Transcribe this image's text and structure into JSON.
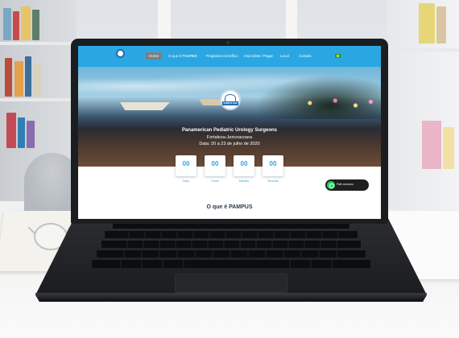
{
  "nav": {
    "items": [
      "Home",
      "O que é PAMPUS",
      "Programa Científico",
      "Inscrições / Pagar",
      "Local",
      "Contato"
    ]
  },
  "hero": {
    "logo_text": "PAMPUS 2020",
    "title": "Panamerican Pediatric Urology Surgeons",
    "location": "Fortaleza-Jericoacoara",
    "date": "Data: 20 a 23 de julho de 2020"
  },
  "countdown": [
    {
      "value": "00",
      "label": "Days"
    },
    {
      "value": "00",
      "label": "Hours"
    },
    {
      "value": "00",
      "label": "Minutes"
    },
    {
      "value": "00",
      "label": "Seconds"
    }
  ],
  "whatsapp": {
    "label": "Fale conosco"
  },
  "section": {
    "title": "O que é PAMPUS"
  },
  "colors": {
    "nav": "#2aa7e3",
    "accent": "#2aa7e3",
    "whatsapp": "#25d366"
  }
}
